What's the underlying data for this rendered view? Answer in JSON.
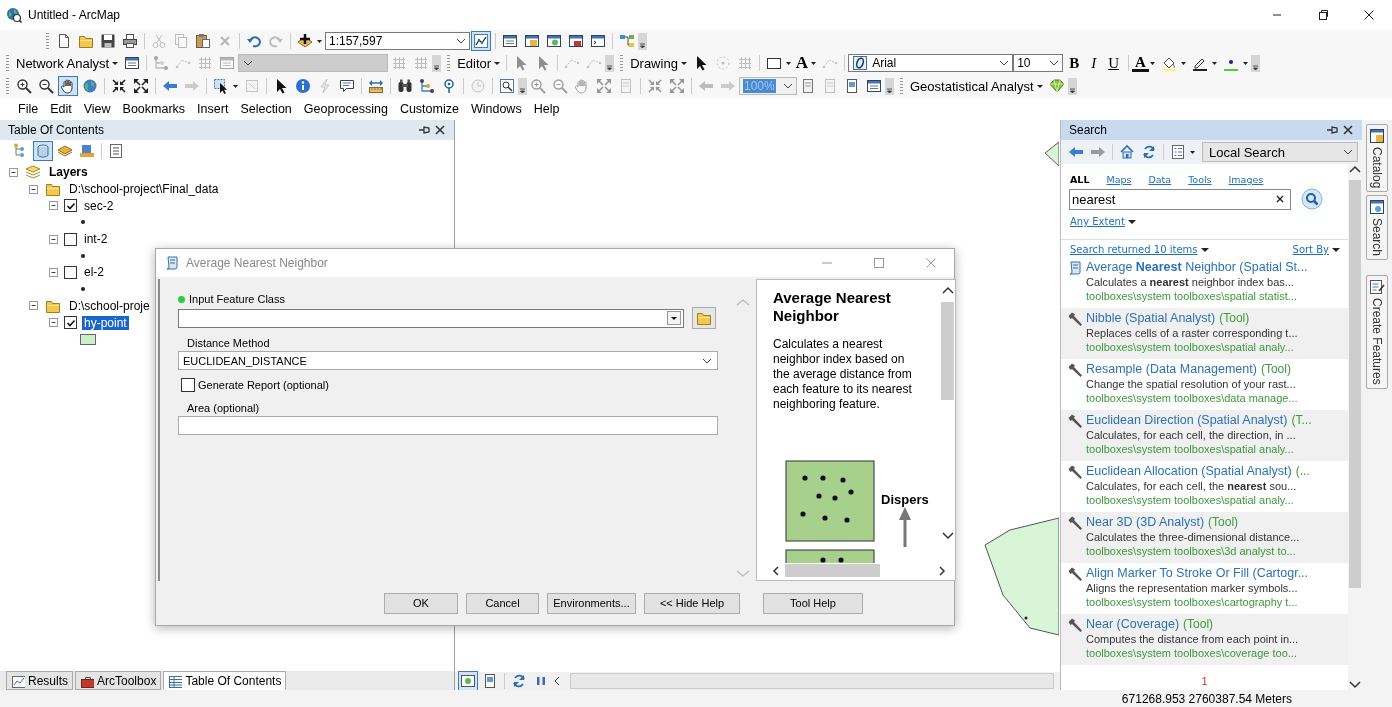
{
  "window": {
    "title": "Untitled - ArcMap"
  },
  "toolbars": {
    "scale": "1:157,597",
    "chart_tool_active": true,
    "network_analyst": "Network Analyst",
    "editor": "Editor",
    "drawing": "Drawing",
    "text_tool": "A",
    "font": "Arial",
    "font_size": "10",
    "bold": "B",
    "italic": "I",
    "underline": "U",
    "font_color": "A",
    "pan_active": true,
    "zoom_percent": "100%",
    "geostatistical_analyst": "Geostatistical Analyst"
  },
  "menu": [
    "File",
    "Edit",
    "View",
    "Bookmarks",
    "Insert",
    "Selection",
    "Geoprocessing",
    "Customize",
    "Windows",
    "Help"
  ],
  "toc": {
    "title": "Table Of Contents",
    "views": [
      {
        "selected": false
      },
      {
        "selected": true
      },
      {
        "selected": false
      },
      {
        "selected": false
      },
      {
        "selected": false
      }
    ],
    "tree": [
      {
        "label": "Layers",
        "kind": "frame",
        "expanded": true,
        "children": [
          {
            "label": "D:\\school-project\\Final_data",
            "kind": "folder",
            "expanded": true,
            "children": [
              {
                "label": "sec-2",
                "kind": "layer",
                "legend": {
                  "kind": "point"
                },
                "expanded": true,
                "checked": true,
                "selected": false
              },
              {
                "label": "int-2",
                "kind": "layer",
                "legend": {
                  "kind": "point"
                },
                "expanded": true,
                "checked": false,
                "selected": false
              },
              {
                "label": "el-2",
                "kind": "layer",
                "legend": {
                  "kind": "point"
                },
                "expanded": true,
                "checked": false,
                "selected": false
              }
            ]
          },
          {
            "label": "D:\\school-proje",
            "kind": "folder",
            "expanded": true,
            "children": [
              {
                "label": "hy-point",
                "kind": "layer",
                "legend": {
                  "kind": "polygon"
                },
                "expanded": true,
                "checked": true,
                "selected": true
              }
            ]
          }
        ]
      }
    ],
    "tabs": [
      {
        "label": "Results",
        "kind": "results",
        "selected": false
      },
      {
        "label": "ArcToolbox",
        "kind": "toolbox",
        "selected": false
      },
      {
        "label": "Table Of Contents",
        "kind": "toc",
        "selected": true
      }
    ]
  },
  "map": {
    "view_buttons": [
      {
        "kind": "data",
        "selected": true
      },
      {
        "kind": "layout",
        "selected": false
      }
    ]
  },
  "search": {
    "title": "Search",
    "scope": "Local Search",
    "filters": [
      {
        "label": "ALL",
        "selected": true
      },
      {
        "label": "Maps",
        "selected": false
      },
      {
        "label": "Data",
        "selected": false
      },
      {
        "label": "Tools",
        "selected": false
      },
      {
        "label": "Images",
        "selected": false
      }
    ],
    "query": "nearest",
    "extent": "Any Extent",
    "result_count": "Search returned 10 items",
    "sort": "Sort By",
    "results": [
      {
        "kind": "script",
        "title": "Average **Nearest** Neighbor (Spatial St...",
        "description": "Calculates a **nearest** neighbor index bas...",
        "path": "toolboxes\\system toolboxes\\spatial statist..."
      },
      {
        "kind": "tool",
        "title": "Nibble (Spatial Analyst)",
        "tag": "(Tool)",
        "description": "Replaces cells of a raster corresponding t...",
        "path": "toolboxes\\system toolboxes\\spatial analy..."
      },
      {
        "kind": "tool",
        "title": "Resample (Data Management)",
        "tag": "(Tool)",
        "description": "Change the spatial resolution of your rast...",
        "path": "toolboxes\\system toolboxes\\data manage..."
      },
      {
        "kind": "tool",
        "title": "Euclidean Direction (Spatial Analyst)",
        "tag": "(T...",
        "description": "Calculates, for each cell, the direction, in ...",
        "path": "toolboxes\\system toolboxes\\spatial analy..."
      },
      {
        "kind": "tool",
        "title": "Euclidean Allocation (Spatial Analyst)",
        "tag": "(...",
        "description": "Calculates, for each cell, the **nearest** sou...",
        "path": "toolboxes\\system toolboxes\\spatial analy..."
      },
      {
        "kind": "tool",
        "title": "Near 3D (3D Analyst)",
        "tag": "(Tool)",
        "description": "Calculates the three-dimensional distance...",
        "path": "toolboxes\\system toolboxes\\3d analyst to..."
      },
      {
        "kind": "tool",
        "title": "Align Marker To Stroke Or Fill (Cartogr...",
        "description": "Aligns the representation marker symbols...",
        "path": "toolboxes\\system toolboxes\\cartography t..."
      },
      {
        "kind": "tool",
        "title": "Near (Coverage)",
        "tag": "(Tool)",
        "description": "Computes the distance from each point in...",
        "path": "toolboxes\\system toolboxes\\coverage too..."
      }
    ],
    "page": "1"
  },
  "side_tabs": [
    {
      "label": "Catalog",
      "kind": "catalog"
    },
    {
      "label": "Search",
      "kind": "search"
    },
    {
      "label": "Create Features",
      "kind": "create"
    }
  ],
  "dialog": {
    "title": "Average Nearest Neighbor",
    "parameters": [
      {
        "kind": "combo",
        "label": "Input Feature Class",
        "required": true
      },
      {
        "kind": "select",
        "label": "Distance Method",
        "value": "EUCLIDEAN_DISTANCE",
        "required": false
      },
      {
        "kind": "checkbox",
        "label": "Generate Report (optional)",
        "checked": false,
        "required": false
      },
      {
        "kind": "text",
        "label": "Area (optional)",
        "required": false
      }
    ],
    "help": {
      "title": "Average Nearest Neighbor",
      "text": "Calculates a nearest neighbor index based on the average distance from each feature to its nearest neighboring feature.",
      "illustration_label": "Dispers"
    },
    "buttons": [
      "OK",
      "Cancel",
      "Environments...",
      "<< Hide Help",
      "Tool Help"
    ]
  },
  "status_bar": {
    "coordinates": "671268.953  2760387.54 Meters"
  }
}
